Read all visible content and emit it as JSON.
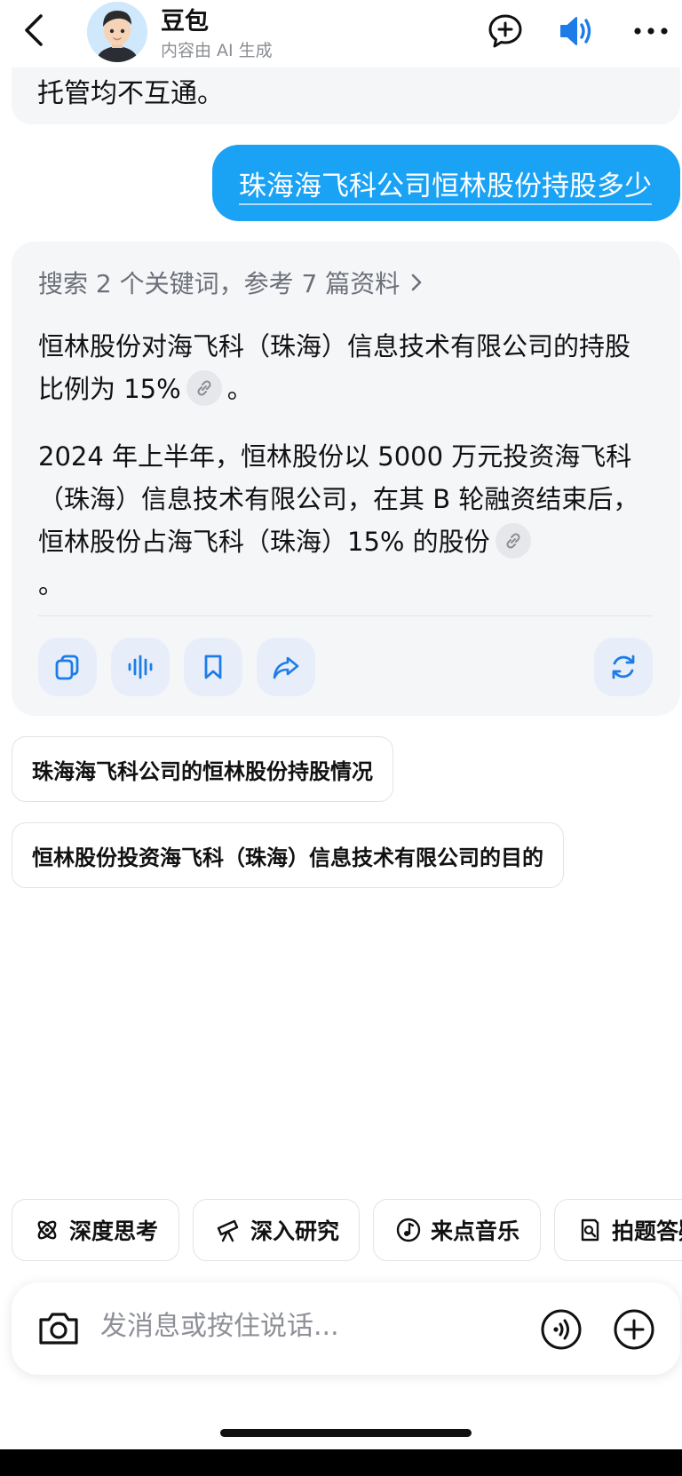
{
  "header": {
    "name": "豆包",
    "subtitle": "内容由 AI 生成"
  },
  "previous_message": {
    "text": "托管均不互通。"
  },
  "user_message": {
    "text": "珠海海飞科公司恒林股份持股多少"
  },
  "ai_message": {
    "search_summary": "搜索 2 个关键词，参考 7 篇资料",
    "paragraph1_a": "恒林股份对海飞科（珠海）信息技术有限公司的持股比例为 15%",
    "paragraph1_b": "。",
    "paragraph2_a": "2024 年上半年，恒林股份以 5000 万元投资海飞科（珠海）信息技术有限公司，在其 B 轮融资结束后，恒林股份占海飞科（珠海）15% 的股份",
    "paragraph2_b": "。"
  },
  "suggestions": [
    "珠海海飞科公司的恒林股份持股情况",
    "恒林股份投资海飞科（珠海）信息技术有限公司的目的"
  ],
  "tools": [
    "深度思考",
    "深入研究",
    "来点音乐",
    "拍题答疑"
  ],
  "input": {
    "placeholder": "发消息或按住说话..."
  },
  "colors": {
    "accent": "#1aa2f5",
    "icon_blue": "#1e7ce8",
    "card_bg": "#f5f6f8",
    "action_bg": "#e7eefa"
  }
}
